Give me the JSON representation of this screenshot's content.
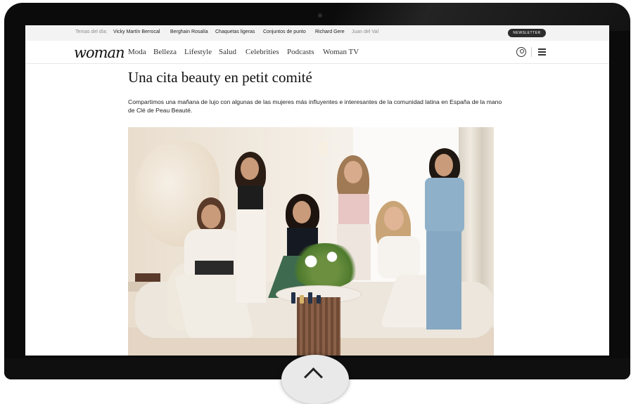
{
  "topics_bar": {
    "label": "Temas del día:",
    "items": [
      "Vicky Martín Berrocal",
      "Berghain Rosalía",
      "Chaquetas ligeras",
      "Conjuntos de punto",
      "Richard Gere",
      "Juan del Val"
    ],
    "newsletter_label": "NEWSLETTER"
  },
  "nav": {
    "logo": "woman",
    "items": [
      "Moda",
      "Belleza",
      "Lifestyle",
      "Salud",
      "Celebrities",
      "Podcasts",
      "Woman TV"
    ],
    "user_icon": "user-circle-icon",
    "menu_icon": "hamburger-menu-icon"
  },
  "article": {
    "headline": "Una cita beauty en petit comité",
    "lede": "Compartimos una mañana de lujo con algunas de las mujeres más influyentes e interesantes de la comunidad latina en España de la mano de Clé de Peau Beauté.",
    "photo_alt": ""
  },
  "device": {
    "play_icon": "chevron-up-icon"
  },
  "colors": {
    "nav_text": "#333333",
    "newsletter_bg": "#2c2c2c",
    "topics_bg": "#f3f3f3"
  }
}
